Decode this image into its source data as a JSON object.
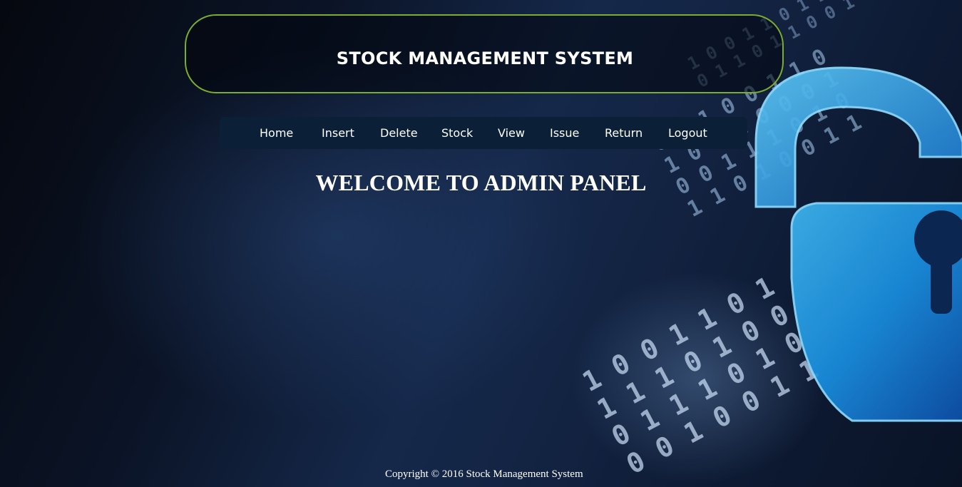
{
  "header": {
    "title": "STOCK MANAGEMENT SYSTEM",
    "border_color": "#7cad2f"
  },
  "nav": {
    "items": [
      {
        "label": "Home"
      },
      {
        "label": "Insert"
      },
      {
        "label": "Delete"
      },
      {
        "label": "Stock"
      },
      {
        "label": "View"
      },
      {
        "label": "Issue"
      },
      {
        "label": "Return"
      },
      {
        "label": "Logout"
      }
    ],
    "background": "#0b1f36"
  },
  "main": {
    "heading": "WELCOME TO ADMIN PANEL"
  },
  "footer": {
    "copyright": "Copyright © 2016 Stock Management System"
  },
  "background": {
    "image": "padlock-icon",
    "theme_color": "#1a8fe0"
  }
}
